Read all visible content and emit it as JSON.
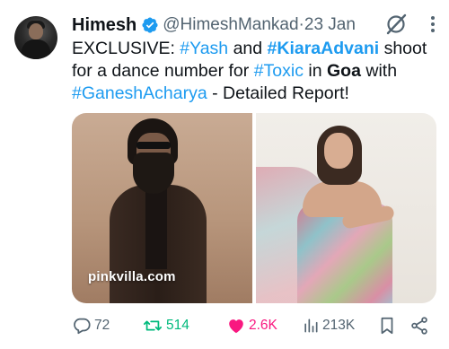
{
  "author": {
    "name": "Himesh",
    "handle": "@HimeshMankad",
    "separator": " · ",
    "date": "23 Jan"
  },
  "tweet": {
    "t1": "EXCLUSIVE: ",
    "t2": "#Yash",
    "t3": " and ",
    "t4": "#KiaraAdvani",
    "t5": " shoot",
    "t6": "for a dance number for ",
    "t7": "#Toxic",
    "t8": " in ",
    "t9": "Goa",
    "t10": " with",
    "t11": "#GaneshAcharya",
    "t12": " - Detailed Report!"
  },
  "media": {
    "watermark": "pinkvilla.com"
  },
  "actions": {
    "replies": "72",
    "retweets": "514",
    "likes": "2.6K",
    "views": "213K"
  },
  "icons": {
    "verified": "verified-badge-icon",
    "grok": "grok-icon",
    "more": "more-icon",
    "reply": "reply-icon",
    "retweet": "retweet-icon",
    "like": "heart-icon",
    "views": "views-icon",
    "bookmark": "bookmark-icon",
    "share": "share-icon"
  },
  "colors": {
    "link": "#1d9bf0",
    "muted": "#536471",
    "retweet": "#00ba7c",
    "like": "#f91880",
    "text": "#0f1419"
  }
}
